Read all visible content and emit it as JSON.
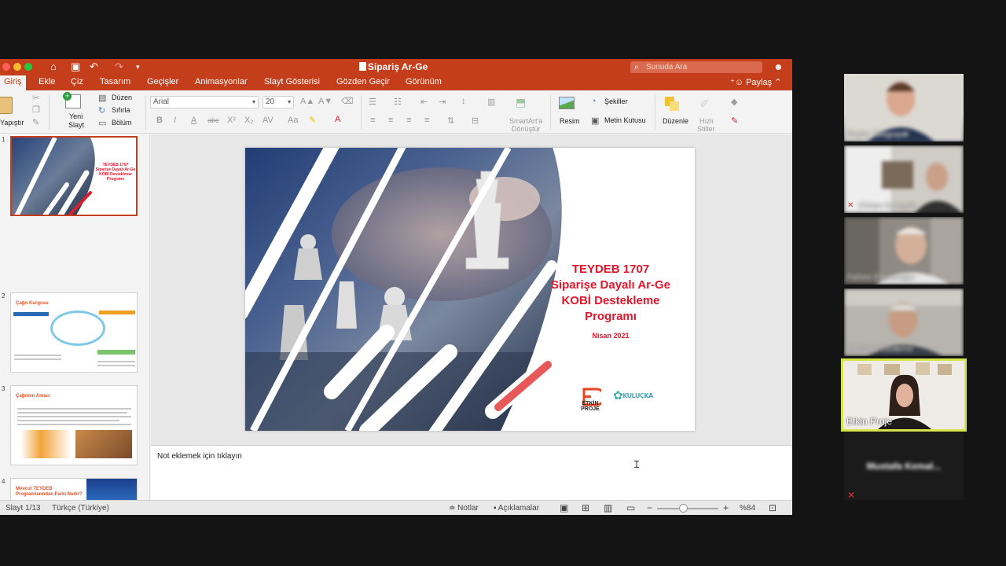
{
  "window": {
    "title": "Sipariş Ar-Ge",
    "search_placeholder": "Sunuda Ara"
  },
  "tabs": [
    {
      "label": "Giriş",
      "active": true
    },
    {
      "label": "Ekle"
    },
    {
      "label": "Çiz"
    },
    {
      "label": "Tasarım"
    },
    {
      "label": "Geçişler"
    },
    {
      "label": "Animasyonlar"
    },
    {
      "label": "Slayt Gösterisi"
    },
    {
      "label": "Gözden Geçir"
    },
    {
      "label": "Görünüm"
    }
  ],
  "share_label": "Paylaş",
  "ribbon": {
    "paste": "Yapıştır",
    "new_slide_1": "Yeni",
    "new_slide_2": "Slayt",
    "layout": "Düzen",
    "reset": "Sıfırla",
    "section": "Bölüm",
    "font_name": "Arial",
    "font_size": "20",
    "smartart_1": "SmartArt'a",
    "smartart_2": "Dönüştür",
    "picture": "Resim",
    "shapes": "Şekiller",
    "textbox": "Metin Kutusu",
    "arrange": "Düzenle",
    "quick_styles_1": "Hızlı",
    "quick_styles_2": "Stiller"
  },
  "thumbnails": [
    {
      "number": "1",
      "heading": "TEYDEB 1707 Siparişe Dayalı Ar-Ge KOBİ Destekleme Programı"
    },
    {
      "number": "2",
      "heading": "Çağrı Kurgusu"
    },
    {
      "number": "3",
      "heading": "Çağrının Amacı"
    },
    {
      "number": "4",
      "heading": "Mevcut TEYDEB Programlarından Farkı Nedir?"
    }
  ],
  "slide": {
    "title_lines": [
      "TEYDEB 1707",
      "Siparişe Dayalı Ar-Ge",
      "KOBİ Destekleme",
      "Programı"
    ],
    "date": "Nisan 2021",
    "logo1_line1": "ETKİN",
    "logo1_line2": "PROJE",
    "logo2": "KULUÇKA"
  },
  "notes_placeholder": "Not eklemek için tıklayın",
  "status": {
    "slide_counter": "Slayt 1/13",
    "language": "Türkçe (Türkiye)",
    "notes": "Notlar",
    "comments": "Açıklamalar",
    "zoom": "%84"
  },
  "participants": [
    {
      "name": "Ergün Tetiguşak",
      "blurred": true
    },
    {
      "name": "Orhan Karagöz",
      "blurred": true
    },
    {
      "name": "Fehmi Efendioğlu",
      "blurred": true
    },
    {
      "name": "Mehmet Özdemir",
      "blurred": true
    },
    {
      "name": "Etkin Proje",
      "blurred": false,
      "active_speaker": true
    },
    {
      "name": "Mustafa Kemal...",
      "blurred": true,
      "video_off": true
    }
  ],
  "colors": {
    "ppt_accent": "#c43e1c",
    "slide_title": "#e3162a",
    "speaker_highlight": "#d6e64a"
  }
}
